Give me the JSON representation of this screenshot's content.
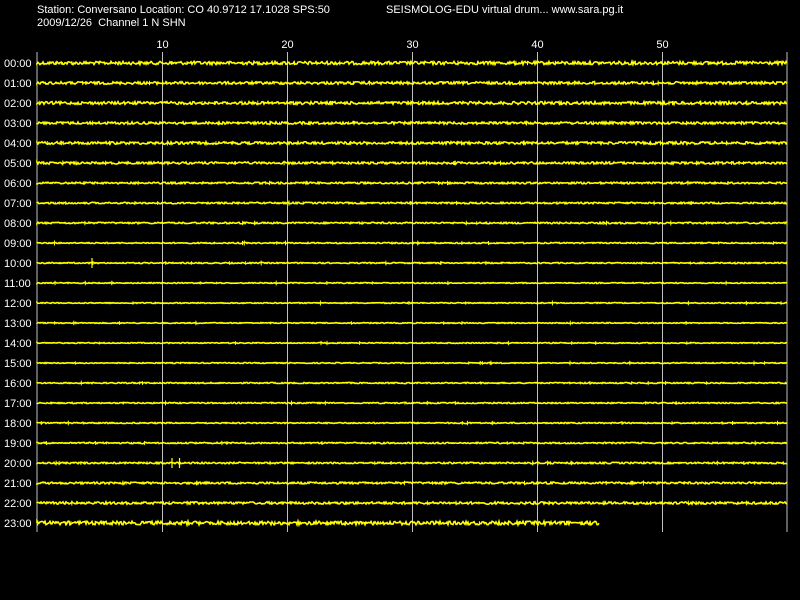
{
  "header": {
    "station_line": "Station: Conversano Location: CO 40.9712 17.1028 SPS:50",
    "date_line": "2009/12/26  Channel 1 N SHN",
    "app_line": "SEISMOLOG-EDU virtual drum... www.sara.pg.it"
  },
  "colors": {
    "background": "#000000",
    "trace": "#ffff00",
    "grid": "#c0c0c0",
    "text": "#ffffff"
  },
  "chart_data": {
    "type": "line",
    "title": "",
    "xlabel": "",
    "ylabel": "",
    "xlim": [
      0,
      60
    ],
    "x_ticks": [
      "10",
      "20",
      "30",
      "40",
      "50"
    ],
    "x_tick_values": [
      10,
      20,
      30,
      40,
      50
    ],
    "grid": true,
    "rows": [
      {
        "label": "00:00",
        "end_minute": 60,
        "noise": 1.6,
        "events": []
      },
      {
        "label": "01:00",
        "end_minute": 60,
        "noise": 1.3,
        "events": []
      },
      {
        "label": "02:00",
        "end_minute": 60,
        "noise": 1.4,
        "events": []
      },
      {
        "label": "03:00",
        "end_minute": 60,
        "noise": 1.2,
        "events": []
      },
      {
        "label": "04:00",
        "end_minute": 60,
        "noise": 1.3,
        "events": []
      },
      {
        "label": "05:00",
        "end_minute": 60,
        "noise": 1.1,
        "events": []
      },
      {
        "label": "06:00",
        "end_minute": 60,
        "noise": 0.9,
        "events": []
      },
      {
        "label": "07:00",
        "end_minute": 60,
        "noise": 0.8,
        "events": []
      },
      {
        "label": "08:00",
        "end_minute": 60,
        "noise": 0.8,
        "events": []
      },
      {
        "label": "09:00",
        "end_minute": 60,
        "noise": 0.6,
        "events": []
      },
      {
        "label": "10:00",
        "end_minute": 60,
        "noise": 0.6,
        "events": [
          {
            "minute": 4.4,
            "amp": 5
          },
          {
            "minute": 32.3,
            "amp": 2
          }
        ]
      },
      {
        "label": "11:00",
        "end_minute": 60,
        "noise": 0.5,
        "events": []
      },
      {
        "label": "12:00",
        "end_minute": 60,
        "noise": 0.5,
        "events": []
      },
      {
        "label": "13:00",
        "end_minute": 60,
        "noise": 0.5,
        "events": []
      },
      {
        "label": "14:00",
        "end_minute": 60,
        "noise": 0.5,
        "events": []
      },
      {
        "label": "15:00",
        "end_minute": 60,
        "noise": 0.5,
        "events": []
      },
      {
        "label": "16:00",
        "end_minute": 60,
        "noise": 0.6,
        "events": [
          {
            "minute": 8.2,
            "amp": 1.5
          }
        ]
      },
      {
        "label": "17:00",
        "end_minute": 60,
        "noise": 0.6,
        "events": []
      },
      {
        "label": "18:00",
        "end_minute": 60,
        "noise": 0.6,
        "events": []
      },
      {
        "label": "19:00",
        "end_minute": 60,
        "noise": 0.7,
        "events": []
      },
      {
        "label": "20:00",
        "end_minute": 60,
        "noise": 0.8,
        "events": [
          {
            "minute": 10.8,
            "amp": 5
          },
          {
            "minute": 11.4,
            "amp": 5
          }
        ]
      },
      {
        "label": "21:00",
        "end_minute": 60,
        "noise": 1.0,
        "events": []
      },
      {
        "label": "22:00",
        "end_minute": 60,
        "noise": 1.2,
        "events": []
      },
      {
        "label": "23:00",
        "end_minute": 45,
        "noise": 1.8,
        "events": []
      }
    ]
  }
}
